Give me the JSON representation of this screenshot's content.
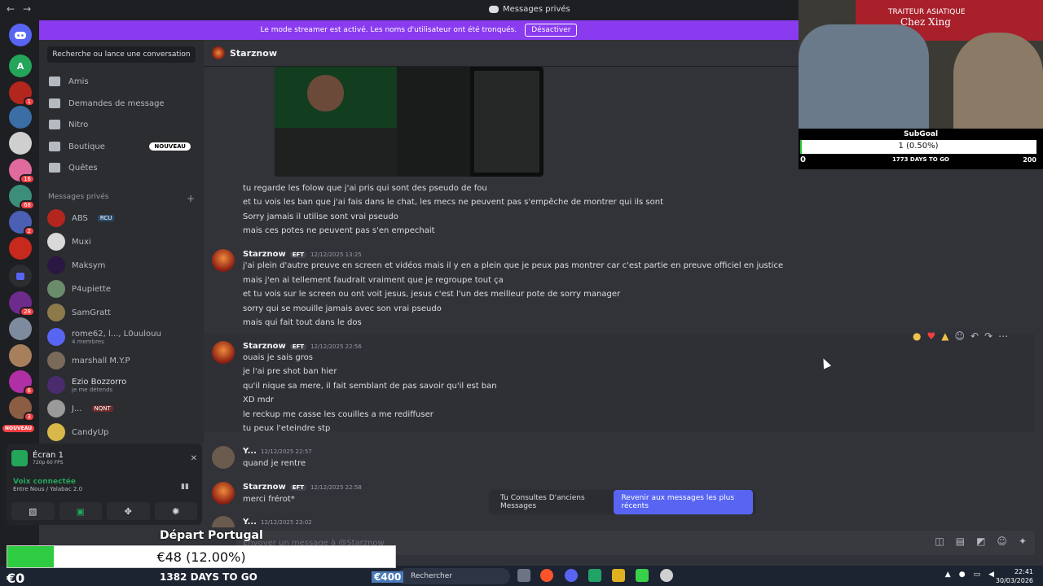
{
  "window": {
    "title": "Messages privés"
  },
  "banner": {
    "text": "Le mode streamer est activé. Les noms d'utilisateur ont été tronqués.",
    "button": "Désactiver"
  },
  "guild_badges": [
    "1",
    "16",
    "68",
    "2",
    "28",
    "6",
    "3",
    "20"
  ],
  "guild_new": "NOUVEAU",
  "sidebar": {
    "search": "Recherche ou lance une conversation",
    "nav": [
      {
        "label": "Amis",
        "icon": "friends-icon"
      },
      {
        "label": "Demandes de message",
        "icon": "mail-icon"
      },
      {
        "label": "Nitro",
        "icon": "nitro-icon"
      },
      {
        "label": "Boutique",
        "icon": "shop-icon",
        "badge": "NOUVEAU"
      },
      {
        "label": "Quêtes",
        "icon": "quests-icon"
      }
    ],
    "dm_header": "Messages privés",
    "dm_add": "+",
    "dms": [
      {
        "name": "ABS",
        "tag": "RCU"
      },
      {
        "name": "Muxi"
      },
      {
        "name": "Maksym"
      },
      {
        "name": "P4upiette"
      },
      {
        "name": "SamGratt"
      },
      {
        "name": "rome62, l..., L0uulouu",
        "sub": "4 membres"
      },
      {
        "name": "marshall M.Y.P"
      },
      {
        "name": "Ezio Bozzorro",
        "sub": "je me détends"
      },
      {
        "name": "J...",
        "tag": "NQNT"
      },
      {
        "name": "CandyUp"
      }
    ]
  },
  "panel": {
    "screen_title": "Écran 1",
    "screen_sub": "720p 60 FPS",
    "voice_title": "Voix connectée",
    "voice_sub": "Entre Nous / Yalabac 2.0",
    "user": "Y..."
  },
  "channel": {
    "name": "Starznow"
  },
  "messages": {
    "block1": [
      "tu regarde les folow que j'ai pris qui sont des pseudo de fou",
      "et tu vois les ban que j'ai fais dans le chat, les mecs ne peuvent pas s'empêche de montrer qui ils sont",
      "Sorry jamais il utilise sont vrai pseudo",
      "mais ces potes ne peuvent pas s'en empechait"
    ],
    "m2": {
      "author": "Starznow",
      "badge": "EFT",
      "time": "12/12/2025 13:25",
      "lines": [
        "j'ai plein d'autre preuve en screen et vidéos mais il y en a plein que je peux pas montrer car c'est partie en preuve officiel en justice",
        "mais j'en ai tellement faudrait vraiment que je regroupe tout ça",
        "et tu vois sur le screen ou ont voit jesus, jesus c'est l'un des meilleur pote de sorry manager",
        "sorry qui se mouille jamais avec son vrai pseudo",
        "mais qui fait tout dans le dos"
      ]
    },
    "m3": {
      "author": "Starznow",
      "badge": "EFT",
      "time": "12/12/2025 22:56",
      "lines": [
        "ouais je sais gros",
        "je l'ai pre shot ban hier",
        "qu'il nique sa mere, il fait semblant de pas savoir qu'il est ban",
        "XD mdr",
        "le reckup me casse les couilles a me rediffuser",
        "tu peux l'eteindre stp"
      ]
    },
    "m4": {
      "author": "Y...",
      "time": "12/12/2025 22:57",
      "lines": [
        "quand je rentre"
      ]
    },
    "m5": {
      "author": "Starznow",
      "badge": "EFT",
      "time": "12/12/2025 22:58",
      "lines": [
        "merci frérot*"
      ]
    },
    "m6": {
      "author": "Y...",
      "time": "12/12/2025 23:02"
    }
  },
  "jump_bar": {
    "text": "Tu Consultes D'anciens Messages",
    "button": "Revenir aux messages les plus récents"
  },
  "composer": {
    "placeholder": "Envoyer un message à @Starznow"
  },
  "webcam": {
    "sign_line1": "TRAITEUR ASIATIQUE",
    "sign_line2": "Chez Xing",
    "goal_title": "SubGoal",
    "goal_value": "1 (0.50%)",
    "goal_progress": 0.005,
    "goal_min": "0",
    "goal_days": "1773 DAYS TO GO",
    "goal_max": "200"
  },
  "overlay": {
    "title": "Départ Portugal",
    "value": "€48 (12.00%)",
    "progress": 0.12,
    "min": "€0",
    "days": "1382 DAYS TO GO",
    "max": "€400"
  },
  "taskbar": {
    "search": "Rechercher",
    "time": "22:41",
    "date": "30/03/2026"
  },
  "colors": {
    "accent": "#5865f2",
    "banner": "#8a3bf0",
    "online": "#23a55a",
    "mention": "#f23f42"
  }
}
